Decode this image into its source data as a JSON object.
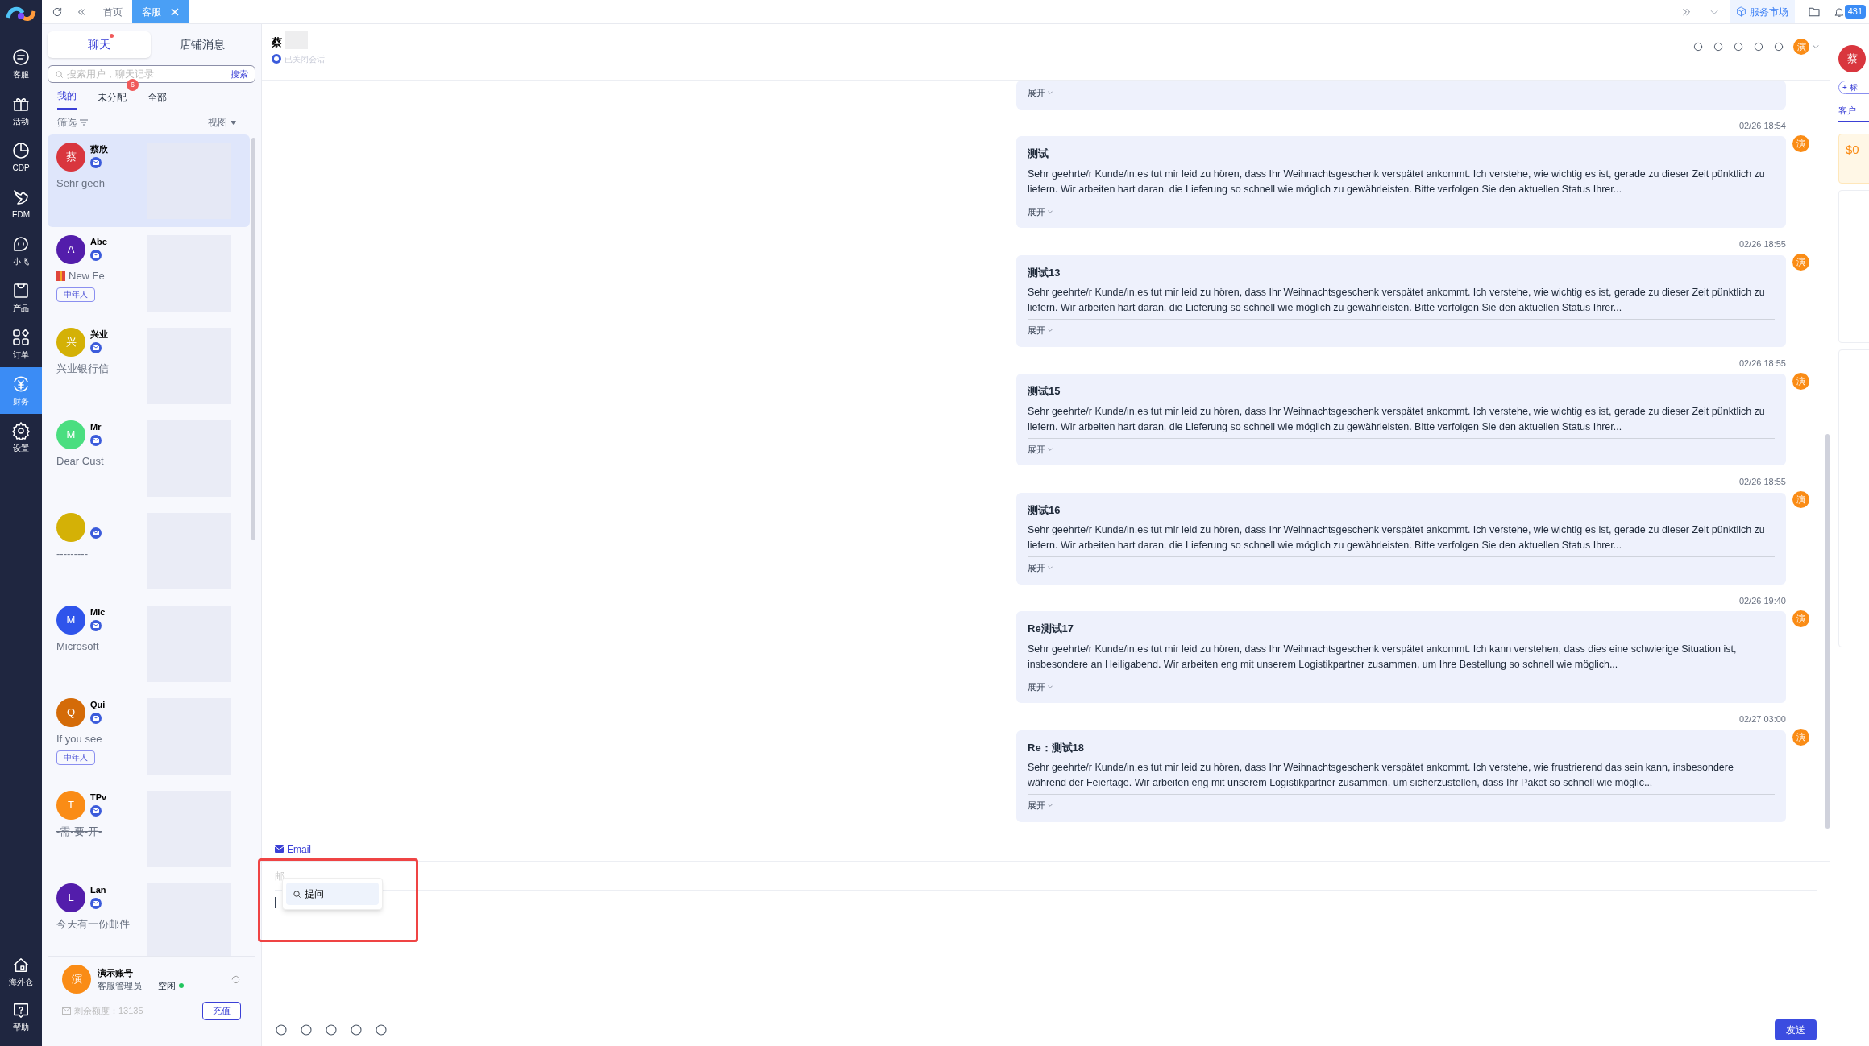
{
  "top_tabs": [
    {
      "label": "首页",
      "selected": false,
      "closable": false
    },
    {
      "label": "客服",
      "selected": true,
      "closable": true
    }
  ],
  "top_right": {
    "market": "服务市场",
    "notifications": "431"
  },
  "nav": [
    {
      "label": "客服",
      "selected": false
    },
    {
      "label": "活动",
      "selected": false
    },
    {
      "label": "CDP",
      "selected": false
    },
    {
      "label": "EDM",
      "selected": false
    },
    {
      "label": "小飞",
      "selected": false
    },
    {
      "label": "产品",
      "selected": false
    },
    {
      "label": "订单",
      "selected": false
    },
    {
      "label": "财务",
      "selected": true
    },
    {
      "label": "设置",
      "selected": false
    }
  ],
  "nav_bottom": [
    {
      "label": "海外仓"
    },
    {
      "label": "帮助"
    }
  ],
  "panel_tabs": [
    {
      "label": "聊天",
      "selected": true,
      "dot": true
    },
    {
      "label": "店铺消息",
      "selected": false,
      "dot": false
    }
  ],
  "search": {
    "placeholder": "搜索用户，聊天记录",
    "button": "搜索"
  },
  "filter_tabs": [
    {
      "label": "我的",
      "selected": true
    },
    {
      "label": "未分配",
      "selected": false,
      "badge": "6"
    },
    {
      "label": "全部",
      "selected": false
    }
  ],
  "filter": "筛选",
  "view": "视图",
  "conversations": [
    {
      "avatar": "蔡",
      "color": "#d9363e",
      "name": "蔡欣",
      "preview": "Sehr geeh",
      "selected": true
    },
    {
      "avatar": "A",
      "color": "#531dab",
      "name": "Abc",
      "preview": "New Fe",
      "gift": true,
      "tags": [
        "中年人"
      ],
      "selected": false
    },
    {
      "avatar": "兴",
      "color": "#d4b106",
      "name": "兴业",
      "preview": "兴业银行信",
      "selected": false
    },
    {
      "avatar": "M",
      "color": "#4ade80",
      "name": "Mr",
      "preview": "Dear Cust",
      "selected": false
    },
    {
      "color": "#d4b106",
      "preview": "---------",
      "selected": false
    },
    {
      "avatar": "M",
      "color": "#2f54eb",
      "name": "Mic",
      "preview": "Microsoft",
      "selected": false
    },
    {
      "avatar": "Q",
      "color": "#d46b08",
      "name": "Qui",
      "preview": "If you see",
      "tags": [
        "中年人"
      ],
      "selected": false
    },
    {
      "avatar": "T",
      "color": "#fa8c16",
      "name": "TPv",
      "preview": "-需-要-开-",
      "strike": true,
      "selected": false
    },
    {
      "avatar": "L",
      "color": "#531dab",
      "name": "Lan",
      "preview": "今天有一份邮件",
      "selected": false
    }
  ],
  "account": {
    "avatar": "演",
    "name": "演示账号",
    "role": "客服管理员",
    "status": "空闲",
    "online": true,
    "quota": "剩余额度：13135",
    "recharge": "充值"
  },
  "chat": {
    "name": "蔡",
    "status": "已关闭会话",
    "agent": "演"
  },
  "messages": [
    {
      "expand": "展开"
    },
    {
      "time": "02/26 18:54",
      "title": "测试",
      "body": "Sehr geehrte/r Kunde/in,es tut mir leid zu hören, dass Ihr Weihnachtsgeschenk verspätet ankommt. Ich verstehe, wie wichtig es ist, gerade zu dieser Zeit pünktlich zu liefern. Wir arbeiten hart daran, die Lieferung so schnell wie möglich zu gewährleisten. Bitte verfolgen Sie den aktuellen Status Ihrer...",
      "expand": "展开",
      "agent": "演"
    },
    {
      "time": "02/26 18:55",
      "title": "测试13",
      "body": "Sehr geehrte/r Kunde/in,es tut mir leid zu hören, dass Ihr Weihnachtsgeschenk verspätet ankommt. Ich verstehe, wie wichtig es ist, gerade zu dieser Zeit pünktlich zu liefern. Wir arbeiten hart daran, die Lieferung so schnell wie möglich zu gewährleisten. Bitte verfolgen Sie den aktuellen Status Ihrer...",
      "expand": "展开",
      "agent": "演"
    },
    {
      "time": "02/26 18:55",
      "title": "测试15",
      "body": "Sehr geehrte/r Kunde/in,es tut mir leid zu hören, dass Ihr Weihnachtsgeschenk verspätet ankommt. Ich verstehe, wie wichtig es ist, gerade zu dieser Zeit pünktlich zu liefern. Wir arbeiten hart daran, die Lieferung so schnell wie möglich zu gewährleisten. Bitte verfolgen Sie den aktuellen Status Ihrer...",
      "expand": "展开",
      "agent": "演"
    },
    {
      "time": "02/26 18:55",
      "title": "测试16",
      "body": "Sehr geehrte/r Kunde/in,es tut mir leid zu hören, dass Ihr Weihnachtsgeschenk verspätet ankommt. Ich verstehe, wie wichtig es ist, gerade zu dieser Zeit pünktlich zu liefern. Wir arbeiten hart daran, die Lieferung so schnell wie möglich zu gewährleisten. Bitte verfolgen Sie den aktuellen Status Ihrer...",
      "expand": "展开",
      "agent": "演"
    },
    {
      "time": "02/26 19:40",
      "title": "Re测试17",
      "body": "Sehr geehrte/r Kunde/in,es tut mir leid zu hören, dass Ihr Weihnachtsgeschenk verspätet ankommt. Ich kann verstehen, dass dies eine schwierige Situation ist, insbesondere an Heiligabend. Wir arbeiten eng mit unserem Logistikpartner zusammen, um Ihre Bestellung so schnell wie möglich...",
      "expand": "展开",
      "agent": "演"
    },
    {
      "time": "02/27 03:00",
      "title": "Re：测试18",
      "body": "Sehr geehrte/r Kunde/in,es tut mir leid zu hören, dass Ihr Weihnachtsgeschenk verspätet ankommt. Ich verstehe, wie frustrierend das sein kann, insbesondere während der Feiertage. Wir arbeiten eng mit unserem Logistikpartner zusammen, um sicherzustellen, dass Ihr Paket so schnell wie möglic...",
      "expand": "展开",
      "agent": "演"
    }
  ],
  "composer": {
    "channel": "Email",
    "subject_placeholder": "邮",
    "suggestion": "提问",
    "send": "发送"
  },
  "side": {
    "avatar": "蔡",
    "add": "+ 标",
    "tab": "客户",
    "amount": "$0"
  }
}
